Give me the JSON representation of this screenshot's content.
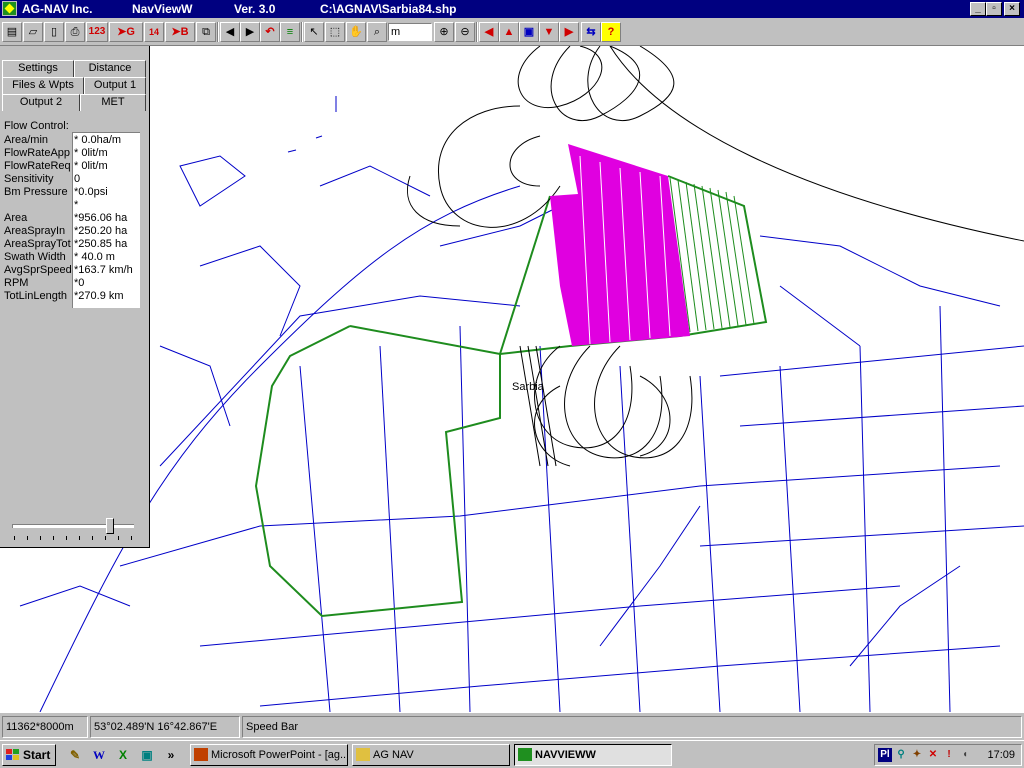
{
  "titlebar": {
    "company": "AG-NAV Inc.",
    "app": "NavViewW",
    "version": "Ver. 3.0",
    "file": "C:\\AGNAV\\Sarbia84.shp",
    "minimize": "_",
    "maximize": "▫",
    "close": "×"
  },
  "toolbar": {
    "counter_label": "123",
    "g_label": "G",
    "grid_label": "14",
    "b_label": "B",
    "zoom_value": "m"
  },
  "panel": {
    "tabs": [
      "Settings",
      "Distance",
      "Files & Wpts",
      "Output 1",
      "Output 2",
      "MET"
    ],
    "active_tab": "Output 2",
    "flow_control_title": "Flow Control:",
    "labels": [
      "Area/min",
      "FlowRateApp",
      "FlowRateReq",
      "Sensitivity",
      "Bm Pressure",
      "",
      "Area",
      "AreaSprayIn",
      "AreaSprayTot",
      "Swath Width",
      "AvgSprSpeed",
      "RPM",
      "TotLinLength"
    ],
    "values": [
      "* 0.0ha/m",
      "*    0lit/m",
      "*    0lit/m",
      "   0",
      "*0.0psi",
      "*",
      "*956.06 ha",
      "*250.20 ha",
      "*250.85 ha",
      "* 40.0 m",
      "*163.7 km/h",
      "*0",
      "*270.9 km"
    ]
  },
  "map": {
    "place_label": "Sarbia"
  },
  "statusbar": {
    "scale": "11362*8000m",
    "coords": "53°02.489'N 16°42.867'E",
    "speed": "Speed Bar"
  },
  "taskbar": {
    "start": "Start",
    "more": "»",
    "tasks": [
      "Microsoft PowerPoint - [ag...",
      "AG NAV",
      "NAVVIEWW"
    ],
    "clock": "17:09",
    "tray_lang": "Pl"
  },
  "colors": {
    "titlebar": "#000080",
    "roads": "#0000c8",
    "field_boundary": "#1e8c1e",
    "sprayed_area": "#e000e0",
    "flight_path": "#000000"
  }
}
